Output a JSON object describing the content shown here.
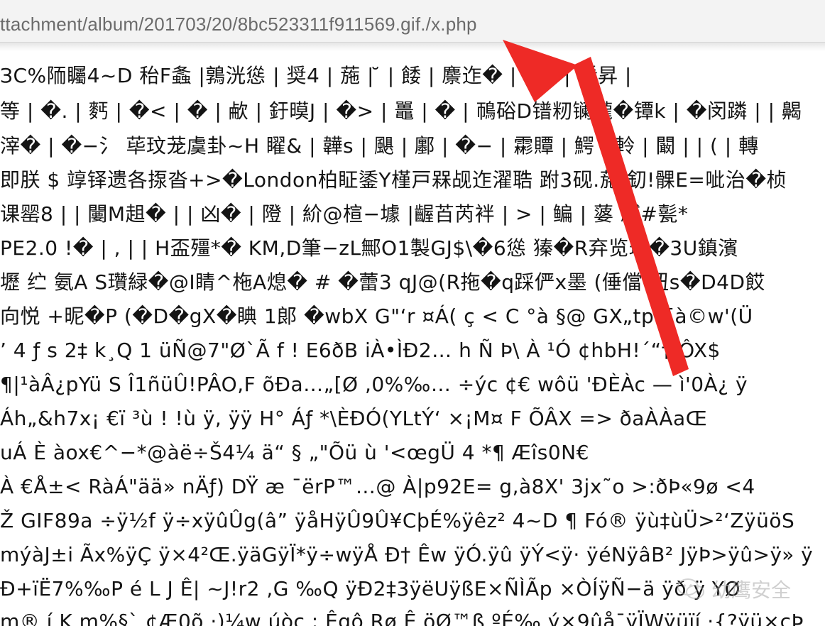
{
  "browser": {
    "url": "ttachment/album/201703/20/8bc523311f911569.gif./x.php"
  },
  "page": {
    "lines": [
      "ЗC%陑矚4~D 秮F螽 |鶉洸慫 | 奨4 | 葹 | ̆ | 餧 | 麖迮� | �1 | 餚昇 |",
      "等 | �. | 麫 | �< | � | 欳 | 釪暯J | �> | 鼉 | � | 鳾硲D镨籾镧櫳�镡k | �闵蹸 | | 齃",
      "滓� | �−氵 荜玟茏虞卦~H 矅& | 韡s | 颶 | 鄽 | �− | 霦贉 | 鰐 | 軨 | 闞 | | ( | 轉",
      "即朕 $ 䇏铎遗各揼沓+>�London柏眐鋈Y槿戸槑觇迮濯聕 跗3砚.葹 釖!髁E=呲治�桢",
      "课罂8 | | 闄M趄� | | 凶� | 隥 | 紒@楦−壉 |齷苩芮袢 | > | 鳊 | 蔢 臧#甏*",
      "PE2.0 !� | , | | H盃殭*� KM,D筆−zL鄦O1製GJ$\\�6慫 獉�R弃览瑷�3U鎮濱",
      "壢 纻 氨A S瓚緑�@I睛^柂A熄� # �蕾3 qJ@(R拖�q踩俨x墨 (倕儅 忸s�D4D餀",
      "向悦 +昵�P (�D�gX�睓 1郞 �wbX G\"‘r ¤Á( ç < C °à §@ GX„tpe[à©w'(Ü",
      "’ 4 ƒ s 2‡ k¸Q 1 üÑ@7\"Ø`Ã f ! E6ðB iÀ•ÌÐ2… h Ñ Þ\\ À ¹Ó ¢hbH!´“†:ÔX$",
      "¶|¹àÂ¿pYü S Î1ñüÛ!PÂO,F õÐa…„[Ø ,0%‰… ÷ýc ¢€ wôü 'ÐÈÀc — ì'0À¿ ÿ",
      "Áh„&h7x¡ €ï ³ù ! !ù ÿ, ÿÿ H° Áƒ *\\ÈÐÓ(YLtÝ‘ ×¡M¤ F ÕÂX => ðaÀÀaŒ",
      "uÁ È àox€^−*@àë÷Š4¼ ä“ § „\"Õü ù '<œgÜ 4 *¶ Æîs0N€",
      "À €Å±< RàÁ\"ää» nÄƒ) DŸ æ ¯ërP™…@ À|p92E= g,à8X' 3jx˜o >:ðÞ«9ø <4",
      "Ž GIF89a ÷ÿ½f ÿ÷xÿûÛg(â” ÿåHÿÛ9Û¥CþÉ%ÿêz² 4~D ¶ Fó® ÿù‡ùÜ>²‘ZÿüöS",
      "mýàJ±i Ãx%ÿÇ ÿ×4²Œ.ÿäGÿÏ*ÿ÷wÿÅ Ð† Êw ÿÓ.ÿû ÿÝ<ÿ· ÿéNÿâB² JÿÞ>ÿû>ÿ» ÿ",
      "Ð+ïË7%‰P é L J Ê| ~J!r2 ,G ‰Q ÿÐ2‡3ÿëUÿßE×ÑÌÃp ×ÒÍÿÑ−ä ÿð ÿ YØ",
      "m® í K m%§` ¢Æ0õ ·)¼w úòc ; Êgô Rø Ê öØ™ß ºÉ‰ ý×9ûå¯ÿÏWÿüïí ·{?ÿü×cÞ"
    ]
  },
  "annotation": {
    "arrow_color": "#ee2a26"
  },
  "watermark": {
    "text": "幼鹰安全",
    "icon": "wechat-icon"
  }
}
